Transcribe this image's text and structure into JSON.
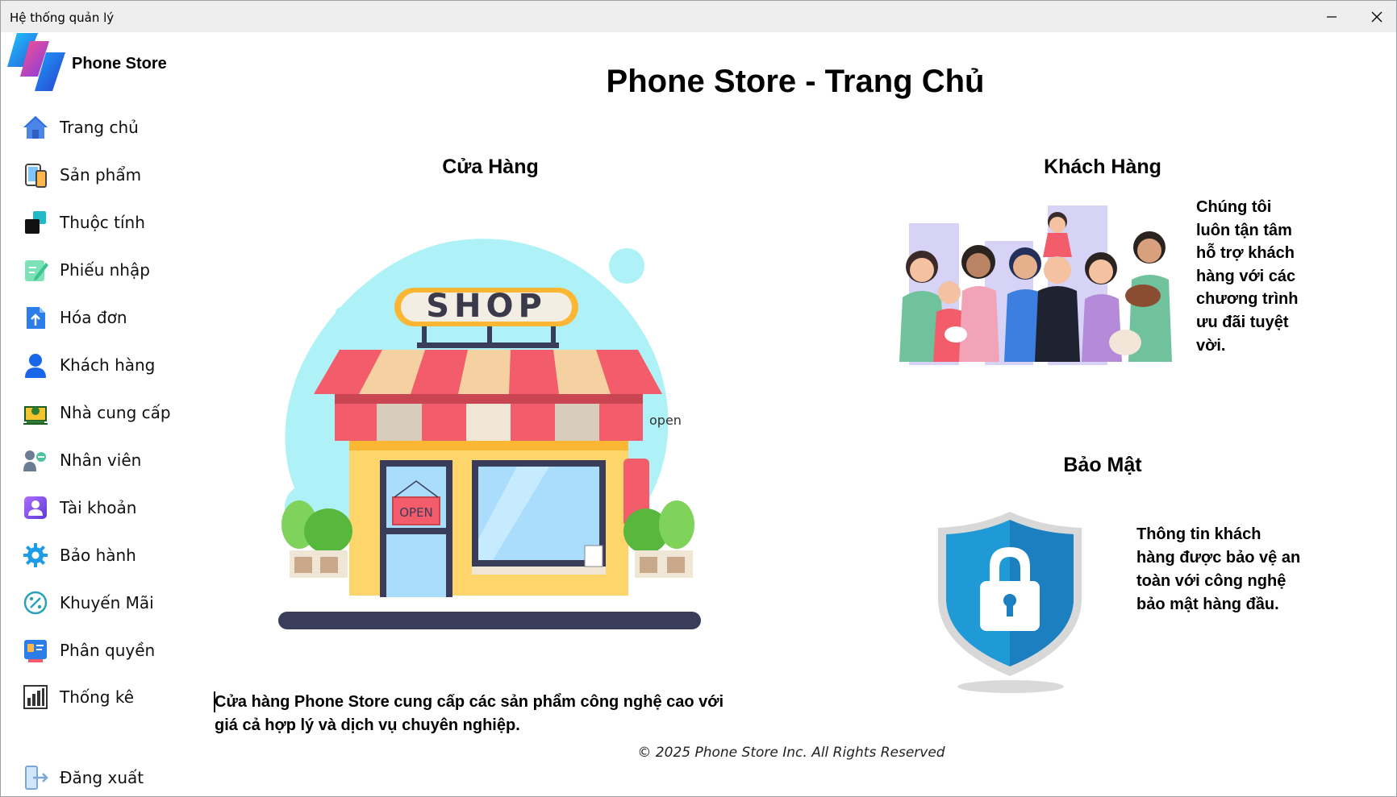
{
  "window": {
    "title": "Hệ thống quản lý"
  },
  "brand": {
    "name": "Phone Store"
  },
  "sidebar": {
    "items": [
      {
        "label": "Trang chủ",
        "icon": "home-icon"
      },
      {
        "label": "Sản phẩm",
        "icon": "devices-icon"
      },
      {
        "label": "Thuộc tính",
        "icon": "attributes-icon"
      },
      {
        "label": "Phiếu nhập",
        "icon": "import-note-icon"
      },
      {
        "label": "Hóa đơn",
        "icon": "invoice-icon"
      },
      {
        "label": "Khách hàng",
        "icon": "customer-icon"
      },
      {
        "label": "Nhà cung cấp",
        "icon": "supplier-icon"
      },
      {
        "label": "Nhân viên",
        "icon": "staff-icon"
      },
      {
        "label": "Tài khoản",
        "icon": "account-icon"
      },
      {
        "label": "Bảo hành",
        "icon": "warranty-gear-icon"
      },
      {
        "label": "Khuyến Mãi",
        "icon": "discount-icon"
      },
      {
        "label": "Phân quyền",
        "icon": "permission-icon"
      },
      {
        "label": "Thống kê",
        "icon": "statistics-icon"
      }
    ],
    "logout": {
      "label": "Đăng xuất",
      "icon": "logout-icon"
    }
  },
  "main": {
    "title": "Phone Store - Trang Chủ",
    "store": {
      "title": "Cửa Hàng",
      "text_line1": "Cửa hàng Phone Store cung cấp các sản phẩm công nghệ cao với",
      "text_line2": "giá cả hợp lý và dịch vụ chuyên nghiệp.",
      "shop_sign": "SHOP",
      "door_sign": "OPEN",
      "side_sign": "open"
    },
    "customers": {
      "title": "Khách Hàng",
      "lines": [
        "Chúng tôi",
        "luôn tận tâm",
        "hỗ trợ khách",
        "hàng với các",
        "chương trình",
        "ưu đãi tuyệt",
        "vời."
      ]
    },
    "security": {
      "title": "Bảo Mật",
      "lines": [
        "Thông tin khách",
        "hàng được bảo vệ an",
        "toàn với công nghệ",
        "bảo mật hàng đầu."
      ]
    },
    "footer": "© 2025 Phone Store Inc. All Rights Reserved"
  },
  "colors": {
    "accent_blue": "#2f6fe0",
    "shield_blue": "#1f8fd0",
    "awning_red": "#f25c6b",
    "blob_cyan": "#aef2f8"
  }
}
